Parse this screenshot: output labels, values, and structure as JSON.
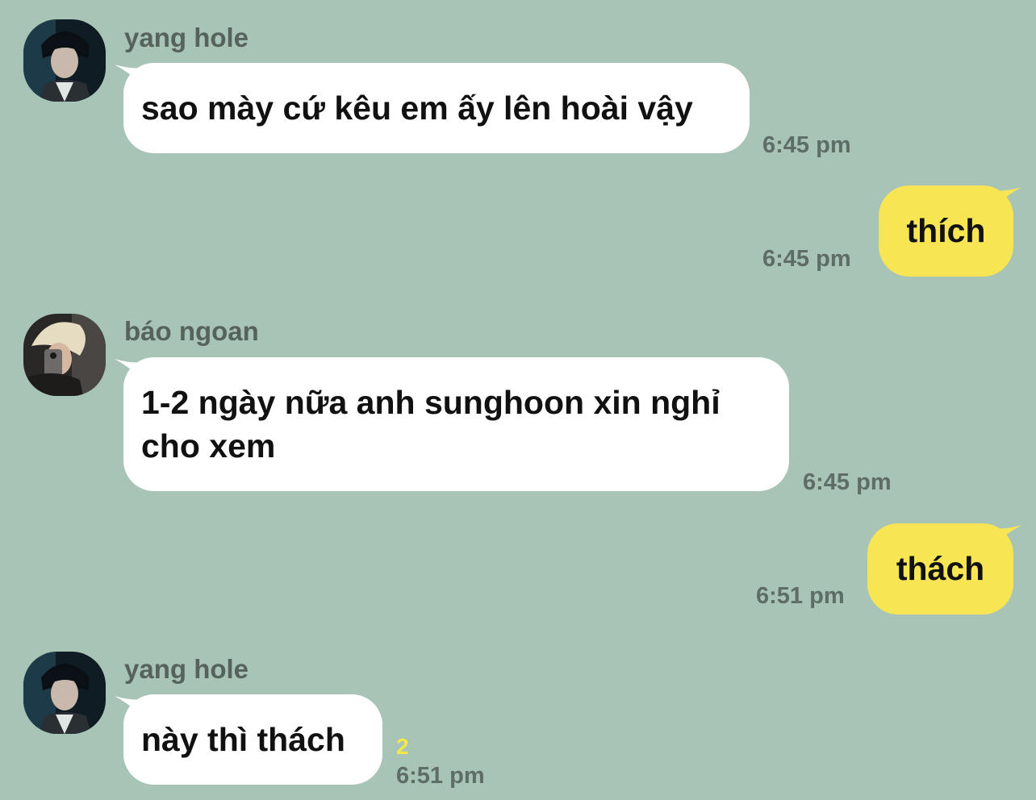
{
  "conversation": {
    "messages": [
      {
        "direction": "incoming",
        "sender": "yang hole",
        "avatar": "avatar-yang-hole",
        "text": "sao mày cứ kêu em ấy lên hoài vậy",
        "time": "6:45 pm"
      },
      {
        "direction": "outgoing",
        "text": "thích",
        "time": "6:45 pm"
      },
      {
        "direction": "incoming",
        "sender": "báo ngoan",
        "avatar": "avatar-bao-ngoan",
        "text": "1-2 ngày nữa anh sunghoon xin nghỉ cho xem",
        "time": "6:45 pm"
      },
      {
        "direction": "outgoing",
        "text": "thách",
        "time": "6:51 pm"
      },
      {
        "direction": "incoming",
        "sender": "yang hole",
        "avatar": "avatar-yang-hole",
        "text": "này thì thách",
        "unread_count": "2",
        "time": "6:51 pm"
      }
    ]
  },
  "colors": {
    "background": "#a7c4b6",
    "incoming_bubble": "#ffffff",
    "outgoing_bubble": "#f7e553",
    "timestamp": "#5e6d66",
    "sender_name": "#56625c",
    "unread_count": "#f5e84a"
  }
}
